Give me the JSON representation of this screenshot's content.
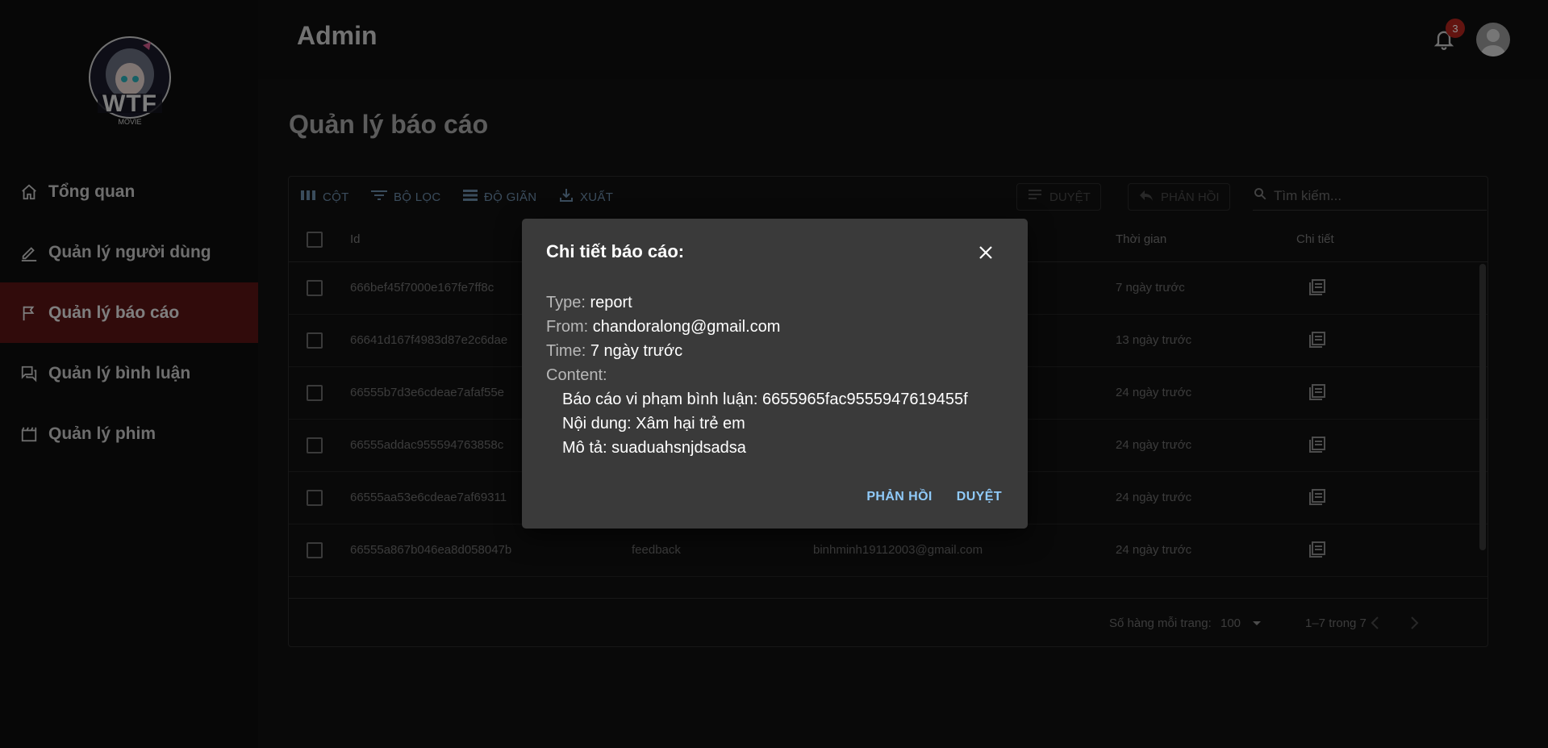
{
  "header": {
    "title": "Admin",
    "notification_count": "3"
  },
  "logo": {
    "text": "WTF",
    "subtext": "MOVIE"
  },
  "sidebar": {
    "items": [
      {
        "label": "Tổng quan",
        "icon": "home-icon",
        "active": false
      },
      {
        "label": "Quản lý người dùng",
        "icon": "edit-icon",
        "active": false
      },
      {
        "label": "Quản lý báo cáo",
        "icon": "flag-icon",
        "active": true
      },
      {
        "label": "Quản lý bình luận",
        "icon": "chat-icon",
        "active": false
      },
      {
        "label": "Quản lý phim",
        "icon": "movie-icon",
        "active": false
      }
    ]
  },
  "page": {
    "title": "Quản lý báo cáo"
  },
  "toolbar": {
    "columns": "CỘT",
    "filter": "BỘ LỌC",
    "density": "ĐỘ GIÃN",
    "export": "XUẤT",
    "approve": "DUYỆT",
    "reply": "PHẢN HỒI",
    "search_placeholder": "Tìm kiếm..."
  },
  "table": {
    "columns": {
      "id": "Id",
      "time": "Thời gian",
      "detail": "Chi tiết"
    },
    "rows": [
      {
        "id": "666bef45f7000e167fe7ff8c",
        "type": "",
        "email": "",
        "time": "7 ngày trước"
      },
      {
        "id": "66641d167f4983d87e2c6dae",
        "type": "",
        "email": "",
        "time": "13 ngày trước"
      },
      {
        "id": "66555b7d3e6cdeae7afaf55e",
        "type": "",
        "email": "",
        "time": "24 ngày trước"
      },
      {
        "id": "66555addac955594763858c",
        "type": "",
        "email": "",
        "time": "24 ngày trước"
      },
      {
        "id": "66555aa53e6cdeae7af69311",
        "type": "",
        "email": "",
        "time": "24 ngày trước"
      },
      {
        "id": "66555a867b046ea8d058047b",
        "type": "feedback",
        "email": "binhminh19112003@gmail.com",
        "time": "24 ngày trước"
      }
    ]
  },
  "pagination": {
    "rows_per_page_label": "Số hàng mỗi trang:",
    "rows_per_page": "100",
    "range": "1–7 trong 7"
  },
  "dialog": {
    "title": "Chi tiết báo cáo:",
    "type_label": "Type:",
    "type_value": "report",
    "from_label": "From:",
    "from_value": "chandoralong@gmail.com",
    "time_label": "Time:",
    "time_value": "7 ngày trước",
    "content_label": "Content:",
    "content_line1": "Báo cáo vi phạm bình luận: 6655965fac9555947619455f",
    "content_line2": "Nội dung: Xâm hại trẻ em",
    "content_line3": "Mô tả: suaduahsnjdsadsa",
    "reply_button": "PHẢN HỒI",
    "approve_button": "DUYỆT"
  },
  "colors": {
    "active_nav": "#5a1414",
    "accent": "#90caf9",
    "badge": "#b3261e"
  }
}
